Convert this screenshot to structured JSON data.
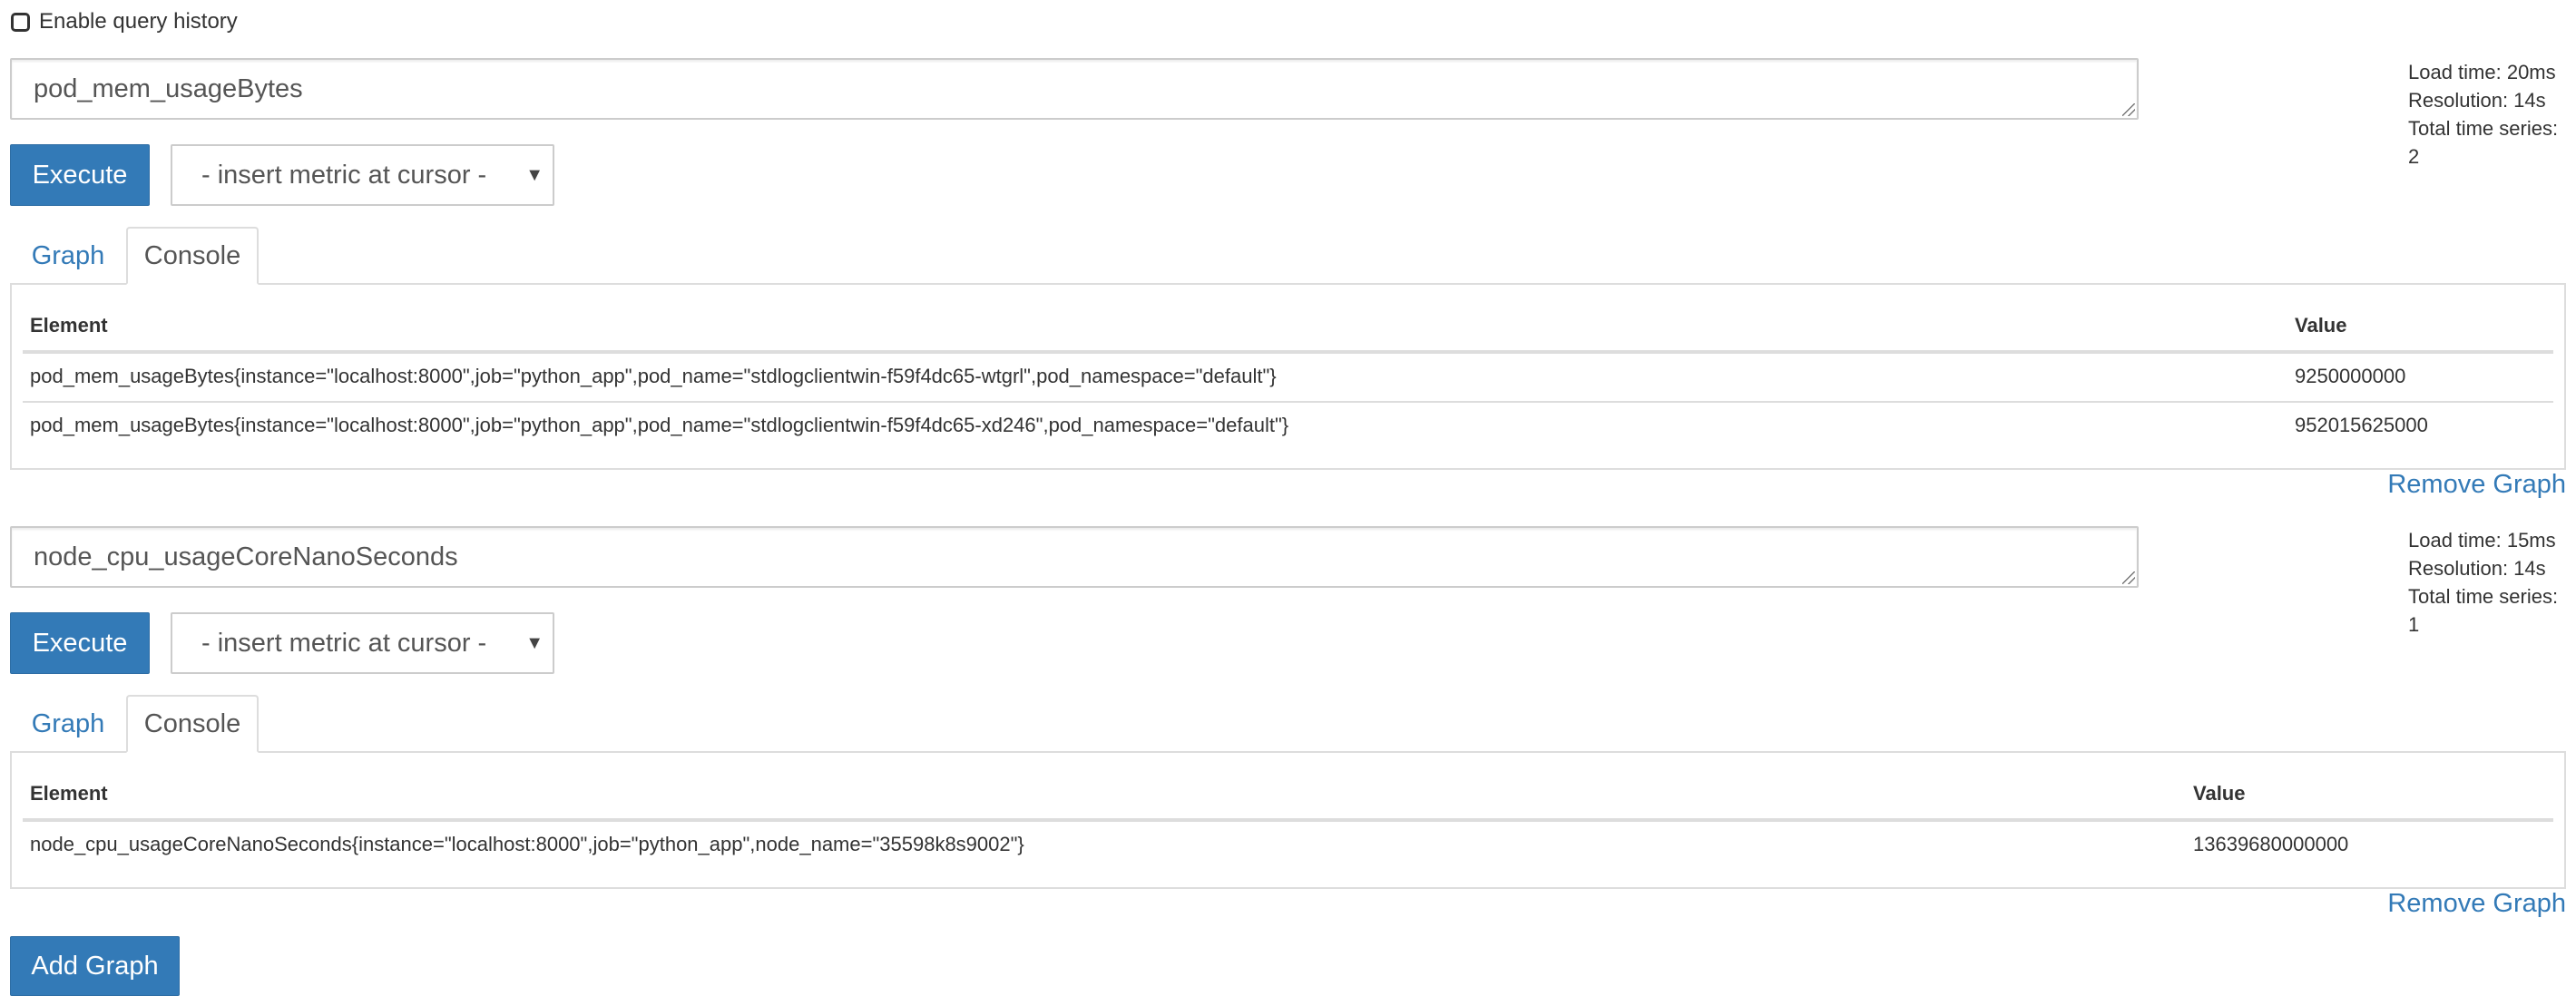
{
  "query_history": {
    "label": "Enable query history",
    "checked": false
  },
  "panels": [
    {
      "expression": "pod_mem_usageBytes",
      "execute_label": "Execute",
      "metric_select": {
        "selected": "- insert metric at cursor -"
      },
      "stats": {
        "load_time": "Load time: 20ms",
        "resolution": "Resolution: 14s",
        "total_series": "Total time series: 2"
      },
      "tabs": [
        {
          "label": "Graph",
          "active": false
        },
        {
          "label": "Console",
          "active": true
        }
      ],
      "table": {
        "columns": [
          "Element",
          "Value"
        ],
        "rows": [
          {
            "element": "pod_mem_usageBytes{instance=\"localhost:8000\",job=\"python_app\",pod_name=\"stdlogclientwin-f59f4dc65-wtgrl\",pod_namespace=\"default\"}",
            "value": "9250000000"
          },
          {
            "element": "pod_mem_usageBytes{instance=\"localhost:8000\",job=\"python_app\",pod_name=\"stdlogclientwin-f59f4dc65-xd246\",pod_namespace=\"default\"}",
            "value": "952015625000"
          }
        ]
      },
      "remove_label": "Remove Graph"
    },
    {
      "expression": "node_cpu_usageCoreNanoSeconds",
      "execute_label": "Execute",
      "metric_select": {
        "selected": "- insert metric at cursor -"
      },
      "stats": {
        "load_time": "Load time: 15ms",
        "resolution": "Resolution: 14s",
        "total_series": "Total time series: 1"
      },
      "tabs": [
        {
          "label": "Graph",
          "active": false
        },
        {
          "label": "Console",
          "active": true
        }
      ],
      "table": {
        "columns": [
          "Element",
          "Value"
        ],
        "rows": [
          {
            "element": "node_cpu_usageCoreNanoSeconds{instance=\"localhost:8000\",job=\"python_app\",node_name=\"35598k8s9002\"}",
            "value": "13639680000000"
          }
        ]
      },
      "remove_label": "Remove Graph"
    }
  ],
  "add_graph_label": "Add Graph",
  "colors": {
    "primary": "#337ab7",
    "border": "#dddddd",
    "text": "#333333"
  }
}
